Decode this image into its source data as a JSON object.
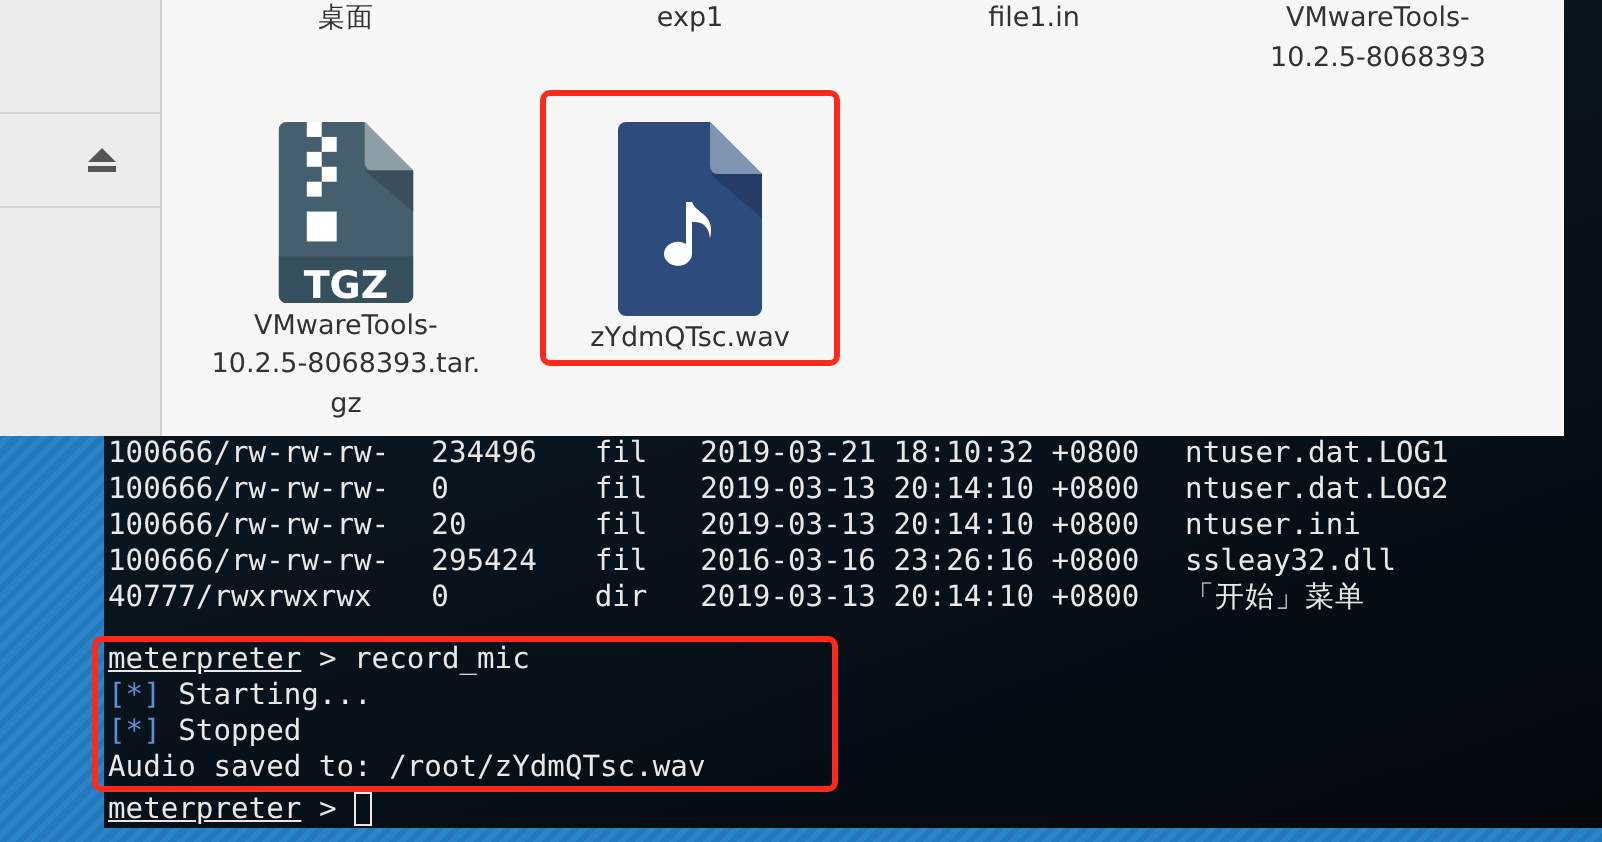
{
  "file_manager": {
    "top_row": [
      {
        "label_lines": [
          "桌面"
        ]
      },
      {
        "label_lines": [
          "exp1"
        ]
      },
      {
        "label_lines": [
          "file1.in"
        ]
      },
      {
        "label_lines": [
          "VMwareTools-",
          "10.2.5-8068393"
        ]
      }
    ],
    "items": [
      {
        "kind": "archive",
        "badge": "TGZ",
        "label_lines": [
          "VMwareTools-",
          "10.2.5-8068393.tar.",
          "gz"
        ],
        "highlighted": false
      },
      {
        "kind": "audio",
        "label_lines": [
          "zYdmQTsc.wav"
        ],
        "highlighted": true
      }
    ]
  },
  "terminal": {
    "listing": [
      {
        "mode": "100666/rw-rw-rw-",
        "size": "234496",
        "type": "fil",
        "modified": "2019-03-21 18:10:32 +0800",
        "name": "ntuser.dat.LOG1"
      },
      {
        "mode": "100666/rw-rw-rw-",
        "size": "0",
        "type": "fil",
        "modified": "2019-03-13 20:14:10 +0800",
        "name": "ntuser.dat.LOG2"
      },
      {
        "mode": "100666/rw-rw-rw-",
        "size": "20",
        "type": "fil",
        "modified": "2019-03-13 20:14:10 +0800",
        "name": "ntuser.ini"
      },
      {
        "mode": "100666/rw-rw-rw-",
        "size": "295424",
        "type": "fil",
        "modified": "2016-03-16 23:26:16 +0800",
        "name": "ssleay32.dll"
      },
      {
        "mode": "40777/rwxrwxrwx",
        "size": "0",
        "type": "dir",
        "modified": "2019-03-13 20:14:10 +0800",
        "name": "「开始」菜单"
      }
    ],
    "highlighted_lines": [
      {
        "kind": "prompt",
        "prompt": "meterpreter",
        "text": "> record_mic"
      },
      {
        "kind": "status",
        "marker": "[*]",
        "text": "Starting..."
      },
      {
        "kind": "status",
        "marker": "[*]",
        "text": "Stopped"
      },
      {
        "kind": "output",
        "text": "Audio saved to: /root/zYdmQTsc.wav"
      }
    ],
    "lines": [
      {
        "kind": "prompt",
        "prompt": "meterpreter",
        "text": ">",
        "cursor": true
      }
    ]
  }
}
